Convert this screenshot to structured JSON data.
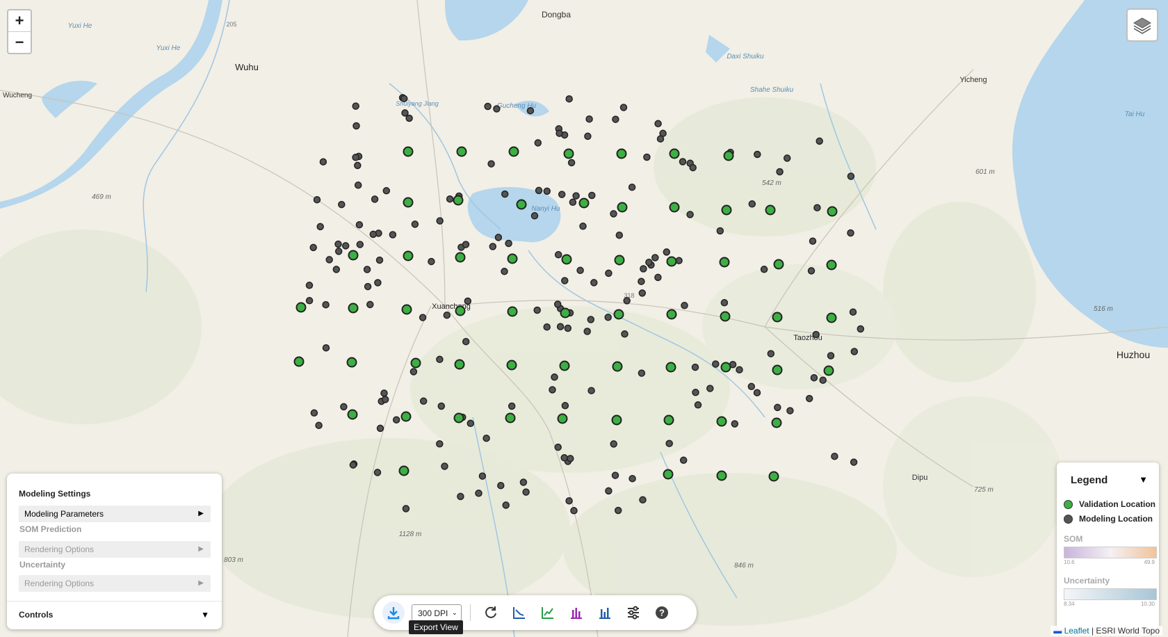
{
  "map": {
    "place_labels": [
      {
        "text": "Dongba"
      },
      {
        "text": "Yuxi He"
      },
      {
        "text": "Yuxi He"
      },
      {
        "text": "Wuhu"
      },
      {
        "text": "Wucheng"
      },
      {
        "text": "Daxi Shuiku"
      },
      {
        "text": "Shahe Shuiku"
      },
      {
        "text": "Yicheng"
      },
      {
        "text": "Tai Hu"
      },
      {
        "text": "Gucheng Hu"
      },
      {
        "text": "Shuiyang Jiang"
      },
      {
        "text": "Nanyi Hu"
      },
      {
        "text": "Xuancheng"
      },
      {
        "text": "Taozhou"
      },
      {
        "text": "Huzhou"
      },
      {
        "text": "Dipu"
      },
      {
        "text": "469 m"
      },
      {
        "text": "542 m"
      },
      {
        "text": "601 m"
      },
      {
        "text": "516 m"
      },
      {
        "text": "1128 m"
      },
      {
        "text": "803 m"
      },
      {
        "text": "846 m"
      },
      {
        "text": "725 m"
      },
      {
        "text": "318"
      },
      {
        "text": "205"
      }
    ],
    "colors": {
      "validation": "#3cb043",
      "modeling": "#555555",
      "water": "#b5d6ec",
      "land": "#f2efe6"
    }
  },
  "zoom": {
    "in_label": "+",
    "out_label": "−"
  },
  "layers_button": {
    "icon": "layers-icon"
  },
  "panel": {
    "title": "Modeling Settings",
    "params_label": "Modeling Parameters",
    "som_label": "SOM Prediction",
    "som_render": "Rendering Options",
    "unc_label": "Uncertainty",
    "unc_render": "Rendering Options",
    "controls_label": "Controls",
    "arrow_right": "▶",
    "arrow_down": "▼"
  },
  "legend": {
    "title": "Legend",
    "arrow": "▼",
    "validation_label": "Validation Location",
    "modeling_label": "Modeling Location",
    "som_label": "SOM",
    "som_min": "10.6",
    "som_max": "49.9",
    "unc_label": "Uncertainty",
    "unc_min": "8.34",
    "unc_max": "10.30"
  },
  "toolbar": {
    "dpi": "300 DPI",
    "tooltip": "Export View",
    "icons": [
      "download-icon",
      "refresh-icon",
      "axis-chart-icon",
      "line-chart-icon",
      "bar-chart-icon",
      "bar-chart-2-icon",
      "sliders-icon",
      "help-icon"
    ]
  },
  "attribution": {
    "leaflet": "Leaflet",
    "source": "| ESRI World Topo"
  }
}
